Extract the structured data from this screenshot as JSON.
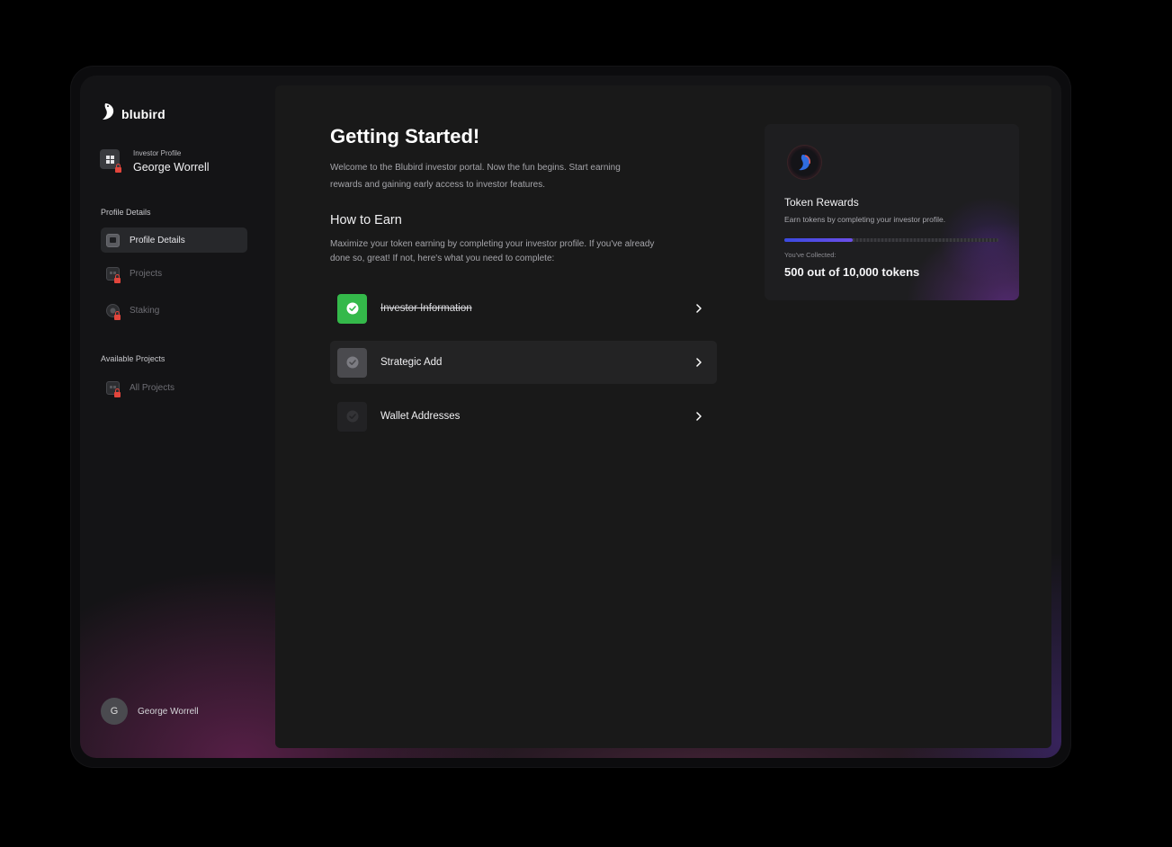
{
  "brand": {
    "name": "blubird"
  },
  "profile": {
    "label": "Investor Profile",
    "name": "George Worrell"
  },
  "sidebar": {
    "sections": [
      {
        "title": "Profile Details",
        "items": [
          {
            "label": "Profile Details",
            "active": true,
            "locked": false
          },
          {
            "label": "Projects",
            "active": false,
            "locked": true
          },
          {
            "label": "Staking",
            "active": false,
            "locked": true
          }
        ]
      },
      {
        "title": "Available Projects",
        "items": [
          {
            "label": "All Projects",
            "active": false,
            "locked": true
          }
        ]
      }
    ]
  },
  "user": {
    "initial": "G",
    "name": "George Worrell"
  },
  "main": {
    "title": "Getting Started!",
    "intro": "Welcome to the Blubird investor portal. Now the fun begins. Start earning rewards and gaining early access to investor features.",
    "how_to_earn": {
      "heading": "How to Earn",
      "text": "Maximize your token earning by completing your investor profile. If you've already done so, great! If not, here's what you need to complete:"
    },
    "tasks": [
      {
        "label": "Investor Information",
        "status": "completed"
      },
      {
        "label": "Strategic Add",
        "status": "pending"
      },
      {
        "label": "Wallet Addresses",
        "status": "pending"
      }
    ]
  },
  "rewards": {
    "title": "Token Rewards",
    "subtitle": "Earn tokens by completing your investor profile.",
    "collected_label": "You've Collected:",
    "collected_value": "500 out of 10,000 tokens",
    "progress_fraction": 0.32
  },
  "colors": {
    "accent_green": "#34b94a",
    "progress_start": "#3b4ae0",
    "progress_end": "#6c4ee8",
    "lock_red": "#e2453c"
  },
  "icons": {
    "brand": "bird-logo-icon",
    "profile": "grid-icon",
    "chevron": "chevron-right-icon",
    "check": "check-circle-icon",
    "lock": "lock-icon"
  }
}
